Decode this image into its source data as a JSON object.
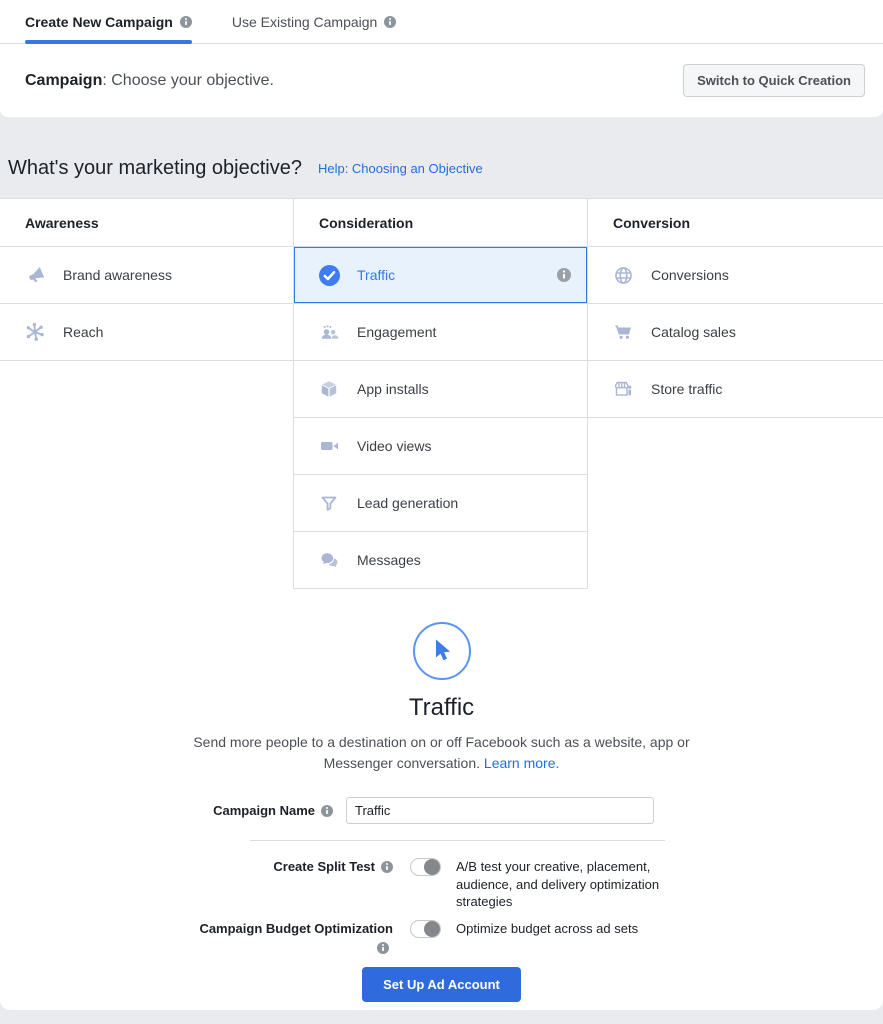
{
  "tabs": {
    "create_new": "Create New Campaign",
    "use_existing": "Use Existing Campaign"
  },
  "header": {
    "section_label": "Campaign",
    "section_desc": ": Choose your objective.",
    "switch_button": "Switch to Quick Creation"
  },
  "objective_band": {
    "question": "What's your marketing objective?",
    "help_link": "Help: Choosing an Objective"
  },
  "objective_grid": {
    "columns": [
      {
        "header": "Awareness",
        "items": [
          {
            "label": "Brand awareness",
            "icon": "megaphone-icon",
            "selected": false
          },
          {
            "label": "Reach",
            "icon": "reach-icon",
            "selected": false
          }
        ]
      },
      {
        "header": "Consideration",
        "items": [
          {
            "label": "Traffic",
            "icon": "check-circle-icon",
            "selected": true,
            "has_info": true
          },
          {
            "label": "Engagement",
            "icon": "people-icon",
            "selected": false
          },
          {
            "label": "App installs",
            "icon": "cube-icon",
            "selected": false
          },
          {
            "label": "Video views",
            "icon": "video-camera-icon",
            "selected": false
          },
          {
            "label": "Lead generation",
            "icon": "funnel-icon",
            "selected": false
          },
          {
            "label": "Messages",
            "icon": "chat-bubbles-icon",
            "selected": false
          }
        ]
      },
      {
        "header": "Conversion",
        "items": [
          {
            "label": "Conversions",
            "icon": "globe-icon",
            "selected": false
          },
          {
            "label": "Catalog sales",
            "icon": "cart-icon",
            "selected": false
          },
          {
            "label": "Store traffic",
            "icon": "storefront-icon",
            "selected": false
          }
        ]
      }
    ]
  },
  "detail": {
    "title": "Traffic",
    "description": "Send more people to a destination on or off Facebook such as a website, app or Messenger conversation.",
    "learn_more": "Learn more."
  },
  "form": {
    "campaign_name_label": "Campaign Name",
    "campaign_name_value": "Traffic",
    "split_test_label": "Create Split Test",
    "split_test_on": false,
    "split_test_desc": "A/B test your creative, placement, audience, and delivery optimization strategies",
    "cbo_label": "Campaign Budget Optimization",
    "cbo_on": false,
    "cbo_desc": "Optimize budget across ad sets",
    "submit_button": "Set Up Ad Account"
  },
  "colors": {
    "accent_blue": "#3578e5",
    "link_blue": "#216fdb",
    "selected_row_bg": "#e7f2fd",
    "icon_blue_gray": "#a9b7d4",
    "info_icon_gray": "#8d949e",
    "submit_button_bg": "#2f6bdd",
    "band_gray": "#e9ebee",
    "border_gray": "#dadde1"
  }
}
